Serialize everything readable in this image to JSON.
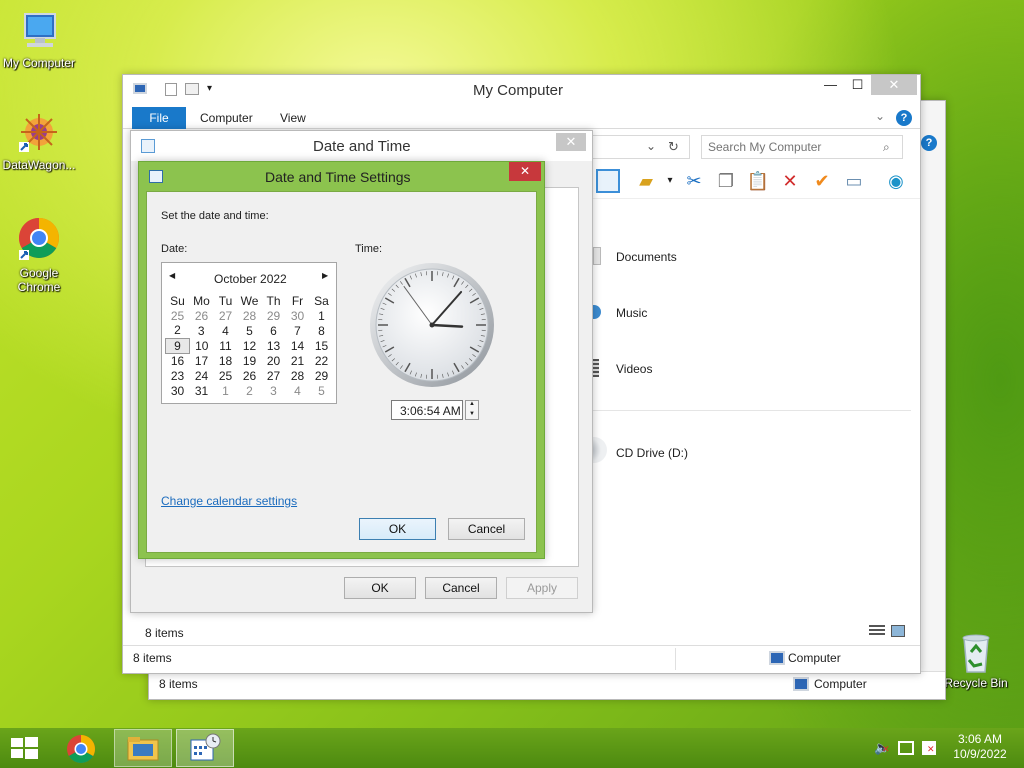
{
  "desktop": {
    "icons": [
      {
        "label": "My Computer",
        "icon": "my-computer-icon"
      },
      {
        "label": "DataWagon...",
        "icon": "datawagon-icon"
      },
      {
        "label": "Google Chrome",
        "icon": "chrome-icon"
      },
      {
        "label": "Recycle Bin",
        "icon": "recycle-bin-icon"
      }
    ]
  },
  "explorer": {
    "title": "My Computer",
    "ribbon_tabs": [
      "File",
      "Computer",
      "View"
    ],
    "search_placeholder": "Search My Computer",
    "items": [
      "Documents",
      "Music",
      "Videos",
      "CD Drive (D:)"
    ],
    "status_items": "8 items",
    "status_location": "Computer",
    "back_status_items": "8 items",
    "back_status_location": "Computer"
  },
  "date_time_dialog": {
    "title": "Date and Time",
    "ok": "OK",
    "cancel": "Cancel",
    "apply": "Apply"
  },
  "settings_dialog": {
    "title": "Date and Time Settings",
    "instruction": "Set the date and time:",
    "date_label": "Date:",
    "time_label": "Time:",
    "month": "October 2022",
    "weekdays": [
      "Su",
      "Mo",
      "Tu",
      "We",
      "Th",
      "Fr",
      "Sa"
    ],
    "weeks": [
      [
        "25",
        "26",
        "27",
        "28",
        "29",
        "30",
        "1"
      ],
      [
        "2",
        "3",
        "4",
        "5",
        "6",
        "7",
        "8"
      ],
      [
        "9",
        "10",
        "11",
        "12",
        "13",
        "14",
        "15"
      ],
      [
        "16",
        "17",
        "18",
        "19",
        "20",
        "21",
        "22"
      ],
      [
        "23",
        "24",
        "25",
        "26",
        "27",
        "28",
        "29"
      ],
      [
        "30",
        "31",
        "1",
        "2",
        "3",
        "4",
        "5"
      ]
    ],
    "selected_day": "9",
    "time_value": "3:06:54 AM",
    "clock": {
      "hour": 3,
      "minute": 6,
      "second": 54
    },
    "link": "Change calendar settings",
    "ok": "OK",
    "cancel": "Cancel"
  },
  "taskbar": {
    "clock_time": "3:06 AM",
    "clock_date": "10/9/2022"
  },
  "colors": {
    "accent": "#1979ca",
    "settings_frame": "#8cc34e",
    "close_red": "#c7383c"
  }
}
